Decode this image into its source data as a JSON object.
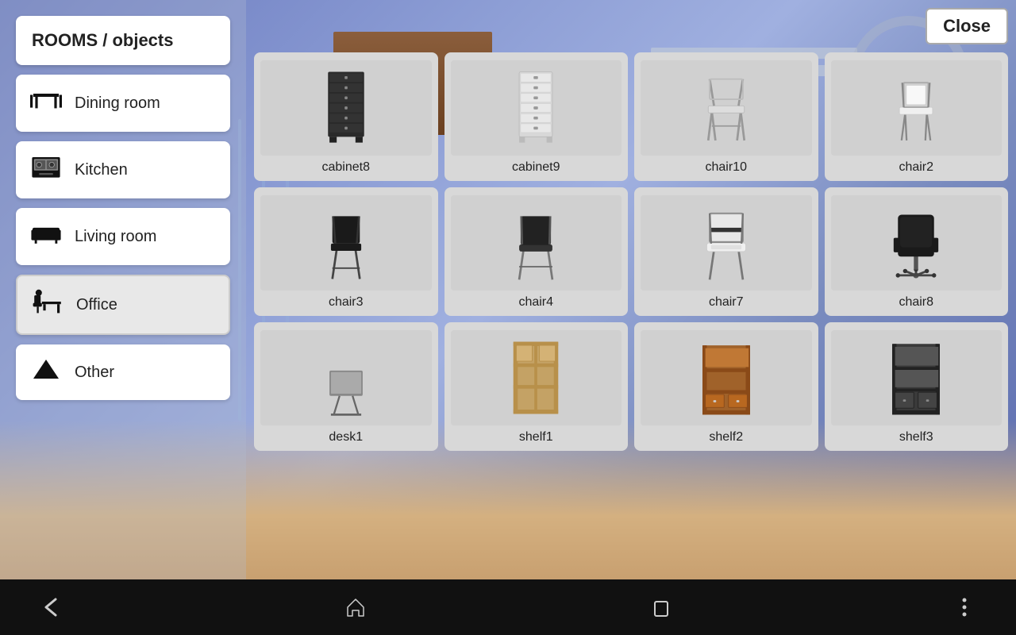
{
  "sidebar": {
    "title": "ROOMS / objects",
    "items": [
      {
        "id": "dining-room",
        "label": "Dining room",
        "icon": "dining"
      },
      {
        "id": "kitchen",
        "label": "Kitchen",
        "icon": "kitchen"
      },
      {
        "id": "living-room",
        "label": "Living room",
        "icon": "living"
      },
      {
        "id": "office",
        "label": "Office",
        "icon": "office",
        "active": true
      },
      {
        "id": "other",
        "label": "Other",
        "icon": "other"
      }
    ]
  },
  "close_button": "Close",
  "grid_items": [
    {
      "id": "cabinet8",
      "label": "cabinet8"
    },
    {
      "id": "cabinet9",
      "label": "cabinet9"
    },
    {
      "id": "chair10",
      "label": "chair10"
    },
    {
      "id": "chair2",
      "label": "chair2"
    },
    {
      "id": "chair3",
      "label": "chair3"
    },
    {
      "id": "chair4",
      "label": "chair4"
    },
    {
      "id": "chair7",
      "label": "chair7"
    },
    {
      "id": "chair8",
      "label": "chair8"
    },
    {
      "id": "desk1",
      "label": "desk1"
    },
    {
      "id": "shelf1",
      "label": "shelf1"
    },
    {
      "id": "shelf2",
      "label": "shelf2"
    },
    {
      "id": "shelf3",
      "label": "shelf3"
    }
  ],
  "nav": {
    "back": "back",
    "home": "home",
    "recents": "recents",
    "more": "more"
  },
  "colors": {
    "bg_room": "#8090c8",
    "sidebar_btn": "#ffffff",
    "grid_bg": "#d8d8d8",
    "accent": "#333333"
  }
}
